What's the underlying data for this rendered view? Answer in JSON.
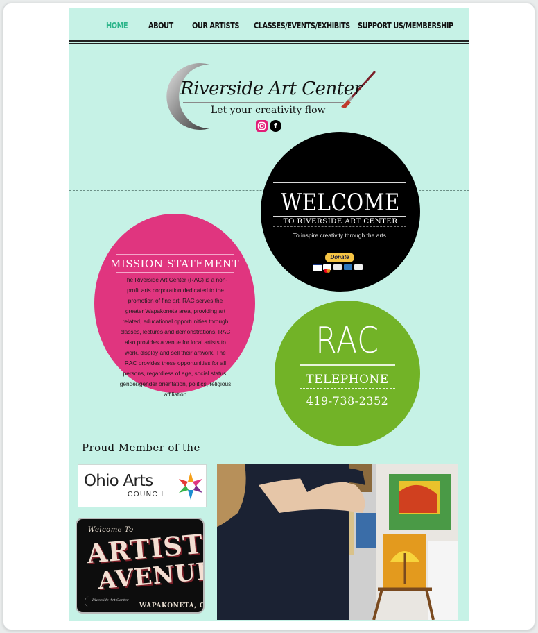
{
  "nav": {
    "items": [
      {
        "label": "HOME",
        "active": true
      },
      {
        "label": "ABOUT",
        "active": false
      },
      {
        "label": "OUR ARTISTS",
        "active": false
      },
      {
        "label": "CLASSES/EVENTS/EXHIBITS",
        "active": false
      },
      {
        "label": "SUPPORT US/MEMBERSHIP",
        "active": false
      }
    ]
  },
  "logo": {
    "title": "Riverside Art Center",
    "tagline": "Let your creativity flow"
  },
  "social": {
    "instagram": "instagram-icon",
    "facebook": "facebook-icon",
    "facebook_glyph": "f"
  },
  "welcome": {
    "title": "WELCOME",
    "subtitle": "TO RIVERSIDE ART CENTER",
    "tagline": "To inspire creativity through the arts.",
    "donate_label": "Donate"
  },
  "mission": {
    "title": "MISSION STATEMENT",
    "body": "The Riverside Art Center (RAC) is a non-profit arts corporation dedicated to the promotion of fine art. RAC serves the greater Wapakoneta area, providing art related, educational opportunities through classes, lectures and demonstrations. RAC also provides a venue for local artists to work, display and sell their artwork. The RAC provides these opportunities for all persons, regardless of age, social status, gender/gender orientation, politics, religious affiliation"
  },
  "contact": {
    "title": "RAC",
    "label": "TELEPHONE",
    "phone": "419-738-2352"
  },
  "members": {
    "heading": "Proud Member of the",
    "oac_name": "Ohio Arts",
    "oac_sub": "COUNCIL",
    "avenue_welcome": "Welcome To",
    "avenue_line1": "ARTIST",
    "avenue_line2": "AVENUE",
    "avenue_town": "WAPAKONETA, OHIO",
    "avenue_brand": "Riverside Art Center"
  },
  "colors": {
    "page_bg": "#c6f2e6",
    "nav_active": "#2bb58a",
    "welcome_circle": "#000000",
    "mission_circle": "#e0357f",
    "contact_circle": "#72b327"
  }
}
